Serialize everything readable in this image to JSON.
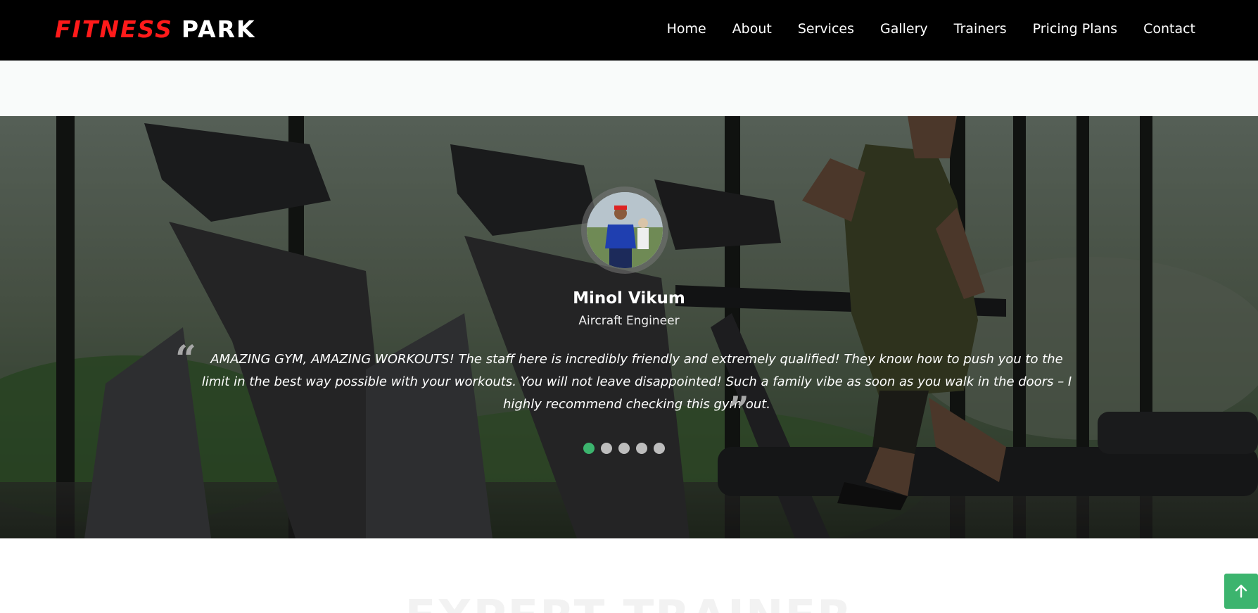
{
  "brand": {
    "part1": "FITNESS",
    "part2": "PARK",
    "accent_color": "#ff1a1a"
  },
  "nav": {
    "items": [
      {
        "label": "Home"
      },
      {
        "label": "About"
      },
      {
        "label": "Services"
      },
      {
        "label": "Gallery"
      },
      {
        "label": "Trainers"
      },
      {
        "label": "Pricing Plans"
      },
      {
        "label": "Contact"
      }
    ]
  },
  "testimonial": {
    "name": "Minol Vikum",
    "role": "Aircraft Engineer",
    "quote": "AMAZING GYM, AMAZING WORKOUTS! The staff here is incredibly friendly and extremely qualified! They know how to push you to the limit in the best way possible with your workouts. You will not leave disappointed! Such a family vibe as soon as you walk in the doors – I highly recommend checking this gym out.",
    "quote_open_glyph": "“",
    "quote_close_glyph": "”",
    "slide_count": 5,
    "active_slide": 1,
    "active_dot_color": "#3cb46e"
  },
  "next_section": {
    "heading": "EXPERT TRAINER"
  },
  "back_to_top": {
    "icon": "arrow-up-icon",
    "color": "#3cb46e"
  }
}
